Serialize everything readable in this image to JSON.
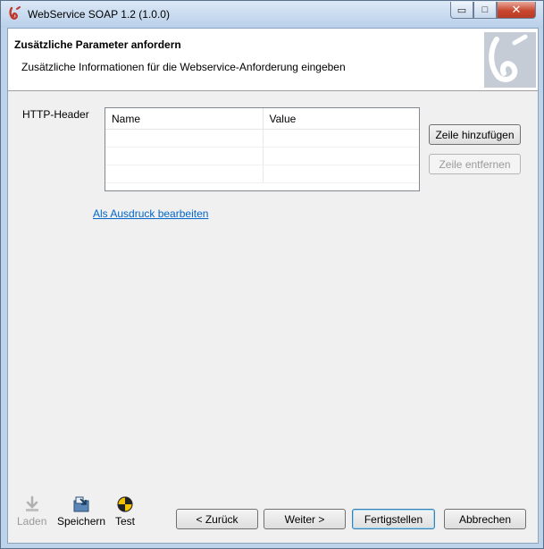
{
  "window": {
    "title": "WebService SOAP 1.2 (1.0.0)",
    "controls": {
      "minimize": "▭",
      "maximize": "□",
      "close": "✕"
    }
  },
  "header": {
    "title": "Zusätzliche Parameter anfordern",
    "description": "Zusätzliche Informationen für die Webservice-Anforderung eingeben"
  },
  "form": {
    "http_header_label": "HTTP-Header",
    "table": {
      "columns": [
        "Name",
        "Value"
      ],
      "rows": [
        {
          "name": "",
          "value": ""
        },
        {
          "name": "",
          "value": ""
        },
        {
          "name": "",
          "value": ""
        }
      ]
    },
    "add_row_label": "Zeile hinzufügen",
    "remove_row_label": "Zeile entfernen",
    "edit_as_expression_link": "Als Ausdruck bearbeiten"
  },
  "toolbar": {
    "load_label": "Laden",
    "save_label": "Speichern",
    "test_label": "Test"
  },
  "nav": {
    "back_label": "< Zurück",
    "next_label": "Weiter >",
    "finish_label": "Fertigstellen",
    "cancel_label": "Abbrechen"
  },
  "colors": {
    "accent": "#c9472f",
    "link": "#0066cc",
    "frame": "#bcd3ea"
  }
}
